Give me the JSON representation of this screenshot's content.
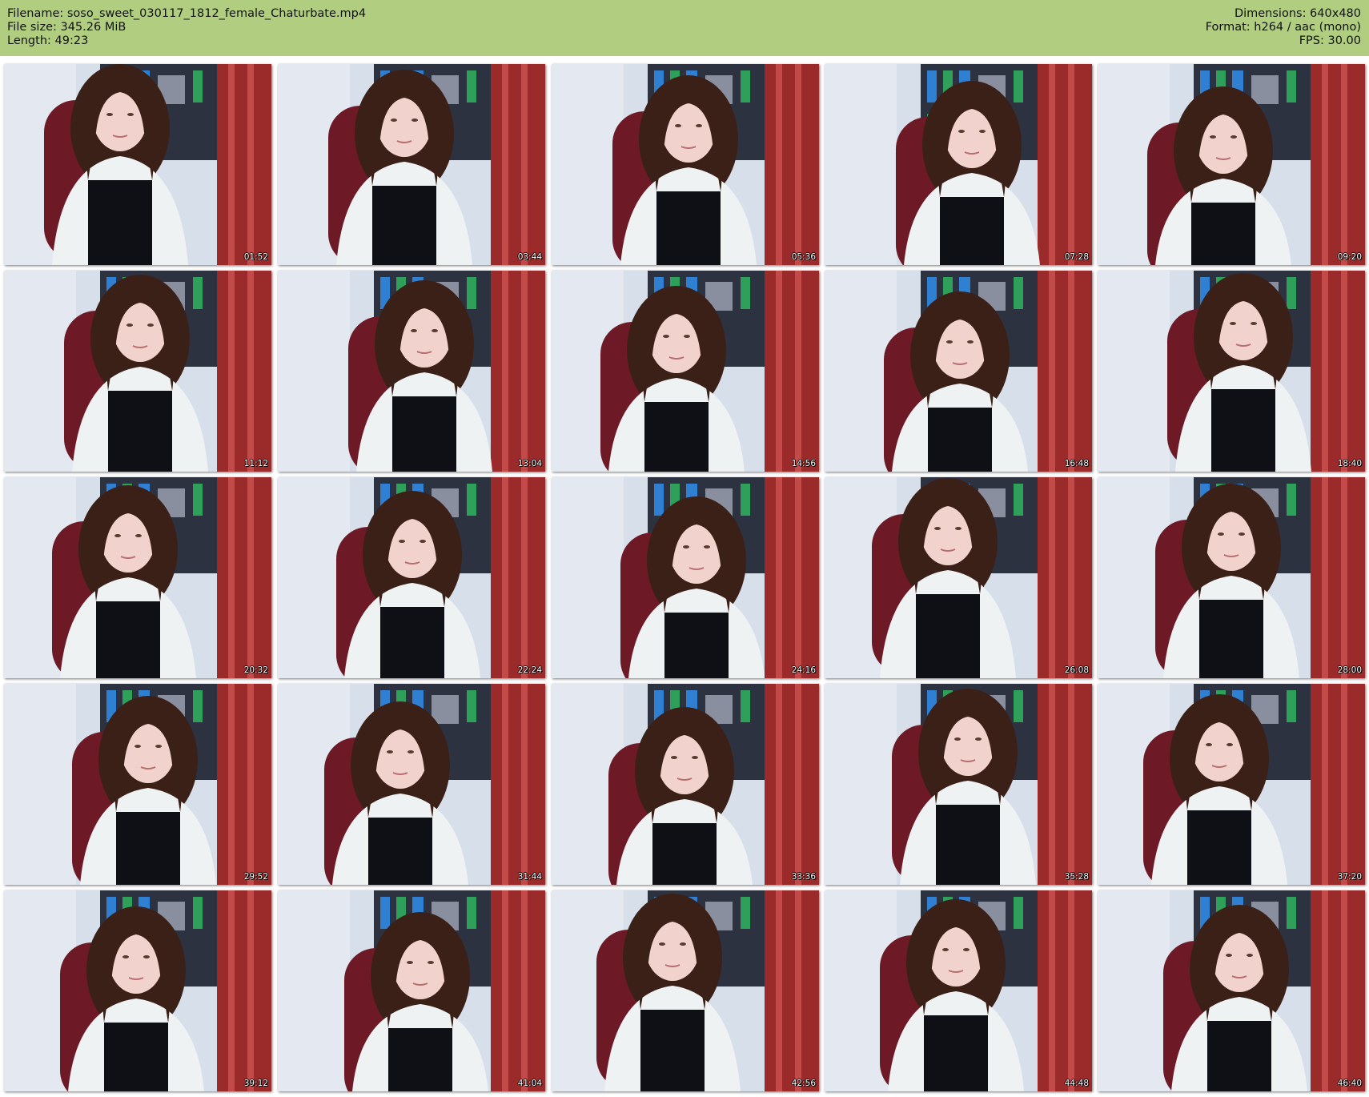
{
  "header": {
    "filename": "Filename: soso_sweet_030117_1812_female_Chaturbate.mp4",
    "filesize": "File size: 345.26 MiB",
    "length": "Length: 49:23",
    "dimensions": "Dimensions: 640x480",
    "format": "Format: h264 / aac (mono)",
    "fps": "FPS: 30.00"
  },
  "colors": {
    "header_bg": "#b1ce80",
    "wall": "#d7dfeb",
    "curtain": "#9b2a2a",
    "chair": "#6d1a26",
    "shirt": "#eef2f3",
    "top": "#0e1016",
    "hair": "#3b2018",
    "skin": "#f2d2cc"
  },
  "thumbnails": [
    {
      "time": "01:52"
    },
    {
      "time": "03:44"
    },
    {
      "time": "05:36"
    },
    {
      "time": "07:28"
    },
    {
      "time": "09:20"
    },
    {
      "time": "11:12"
    },
    {
      "time": "13:04"
    },
    {
      "time": "14:56"
    },
    {
      "time": "16:48"
    },
    {
      "time": "18:40"
    },
    {
      "time": "20:32"
    },
    {
      "time": "22:24"
    },
    {
      "time": "24:16"
    },
    {
      "time": "26:08"
    },
    {
      "time": "28:00"
    },
    {
      "time": "29:52"
    },
    {
      "time": "31:44"
    },
    {
      "time": "33:36"
    },
    {
      "time": "35:28"
    },
    {
      "time": "37:20"
    },
    {
      "time": "39:12"
    },
    {
      "time": "41:04"
    },
    {
      "time": "42:56"
    },
    {
      "time": "44:48"
    },
    {
      "time": "46:40"
    }
  ]
}
